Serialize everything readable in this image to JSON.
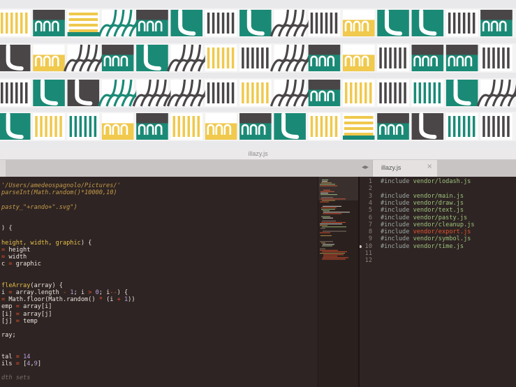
{
  "window": {
    "title": "illazy.js"
  },
  "tabs": [
    {
      "label": "illazy.js",
      "close_icon": "×"
    }
  ],
  "colors": {
    "teal": "#1a8a76",
    "yellow": "#f0c94d",
    "dark": "#4a4647",
    "white": "#ffffff",
    "bg": "#e9e8ea"
  },
  "left_code": [
    [
      {
        "t": "str",
        "v": "'/Users/amedeospagnolo/Pictures/'"
      }
    ],
    [
      {
        "t": "str",
        "v": "parseInt(Math.random()*10000,10)"
      }
    ],
    [],
    [
      {
        "t": "str",
        "v": "pasty_\"+rando+\".svg\")"
      }
    ],
    [],
    [],
    [
      {
        "t": "plain",
        "v": ") {"
      }
    ],
    [],
    [
      {
        "t": "fn",
        "v": "height, width, graphic"
      },
      {
        "t": "plain",
        "v": ") {"
      }
    ],
    [
      {
        "t": "kw",
        "v": "= "
      },
      {
        "t": "plain",
        "v": "height"
      }
    ],
    [
      {
        "t": "kw",
        "v": "= "
      },
      {
        "t": "plain",
        "v": "width"
      }
    ],
    [
      {
        "t": "plain",
        "v": "c "
      },
      {
        "t": "kw",
        "v": "= "
      },
      {
        "t": "plain",
        "v": "graphic"
      }
    ],
    [],
    [],
    [
      {
        "t": "fn",
        "v": "fleArray"
      },
      {
        "t": "plain",
        "v": "(array) {"
      }
    ],
    [
      {
        "t": "plain",
        "v": "i "
      },
      {
        "t": "kw",
        "v": "= "
      },
      {
        "t": "plain",
        "v": "array.length "
      },
      {
        "t": "kw",
        "v": "- "
      },
      {
        "t": "num",
        "v": "1"
      },
      {
        "t": "plain",
        "v": "; i "
      },
      {
        "t": "kw",
        "v": "> "
      },
      {
        "t": "num",
        "v": "0"
      },
      {
        "t": "plain",
        "v": "; i"
      },
      {
        "t": "kw",
        "v": "--"
      },
      {
        "t": "plain",
        "v": ") {"
      }
    ],
    [
      {
        "t": "kw",
        "v": "= "
      },
      {
        "t": "plain",
        "v": "Math.floor(Math.random() "
      },
      {
        "t": "kw",
        "v": "* "
      },
      {
        "t": "plain",
        "v": "(i "
      },
      {
        "t": "kw",
        "v": "+ "
      },
      {
        "t": "num",
        "v": "1"
      },
      {
        "t": "plain",
        "v": "))"
      }
    ],
    [
      {
        "t": "plain",
        "v": "emp "
      },
      {
        "t": "kw",
        "v": "= "
      },
      {
        "t": "plain",
        "v": "array[i]"
      }
    ],
    [
      {
        "t": "plain",
        "v": "[i] "
      },
      {
        "t": "kw",
        "v": "= "
      },
      {
        "t": "plain",
        "v": "array[j]"
      }
    ],
    [
      {
        "t": "plain",
        "v": "[j] "
      },
      {
        "t": "kw",
        "v": "= "
      },
      {
        "t": "plain",
        "v": "temp"
      }
    ],
    [],
    [
      {
        "t": "plain",
        "v": "ray;"
      }
    ],
    [],
    [],
    [
      {
        "t": "plain",
        "v": "tal "
      },
      {
        "t": "kw",
        "v": "= "
      },
      {
        "t": "num",
        "v": "14"
      }
    ],
    [
      {
        "t": "plain",
        "v": "ils "
      },
      {
        "t": "kw",
        "v": "= "
      },
      {
        "t": "plain",
        "v": "["
      },
      {
        "t": "num",
        "v": "4"
      },
      {
        "t": "plain",
        "v": ","
      },
      {
        "t": "num",
        "v": "9"
      },
      {
        "t": "plain",
        "v": "]"
      }
    ],
    [],
    [
      {
        "t": "com",
        "v": "dth sets"
      }
    ]
  ],
  "right_code": [
    {
      "n": "1",
      "inc": "#include ",
      "path": "vendor/lodash.js"
    },
    {
      "n": "2",
      "inc": "",
      "path": ""
    },
    {
      "n": "3",
      "inc": "#include ",
      "path": "vendor/main.js"
    },
    {
      "n": "4",
      "inc": "#include ",
      "path": "vendor/draw.js"
    },
    {
      "n": "5",
      "inc": "#include ",
      "path": "vendor/text.js"
    },
    {
      "n": "6",
      "inc": "#include ",
      "path": "vendor/pasty.js"
    },
    {
      "n": "7",
      "inc": "#include ",
      "path": "vendor/cleanup.js"
    },
    {
      "n": "8",
      "inc": "#include ",
      "path": "vendor/export.js",
      "red": true
    },
    {
      "n": "9",
      "inc": "#include ",
      "path": "vendor/symbol.js"
    },
    {
      "n": "10",
      "inc": "#include ",
      "path": "vendor/time.js",
      "marker": true
    },
    {
      "n": "11",
      "inc": "",
      "path": ""
    },
    {
      "n": "12",
      "inc": "",
      "path": ""
    }
  ],
  "pattern_rows": [
    [
      "stripesV-yel",
      "arch-teal",
      "hstripes-yel",
      "maze-teal",
      "arch-teal",
      "hook-teal",
      "stripesV-dark",
      "hook-teal",
      "maze-dark",
      "stripesV-dark",
      "arch-yel-dark",
      "hook-teal",
      "hook-teal",
      "stripesV-dark",
      "arch-teal"
    ],
    [
      "hook-dark",
      "arch-yel",
      "maze-dark",
      "arch-teal",
      "hook-teal",
      "maze-dark",
      "stripesV-yel",
      "stripesV-dark",
      "maze-dark",
      "arch-teal",
      "arch-yel",
      "stripesV-dark",
      "arch-teal",
      "arch-teal",
      "stripesV-dark"
    ],
    [
      "stripesV-dark",
      "hook-teal",
      "hook-dark",
      "maze-teal",
      "maze-dark",
      "maze-dark",
      "stripesV-dark",
      "stripesV-yel",
      "maze-dark",
      "arch-teal",
      "stripesV-yel",
      "stripesV-dark",
      "stripesV-teal",
      "hook-teal",
      "maze-dark"
    ],
    [
      "hook-teal",
      "stripesV-yel",
      "stripesV-teal",
      "arch-yel",
      "arch-teal",
      "stripesV-yel",
      "arch-yel",
      "arch-teal",
      "hook-teal",
      "stripesV-yel",
      "hstripes-yel",
      "arch-teal",
      "hook-dark",
      "stripesV-teal",
      "stripesV-dark"
    ]
  ]
}
